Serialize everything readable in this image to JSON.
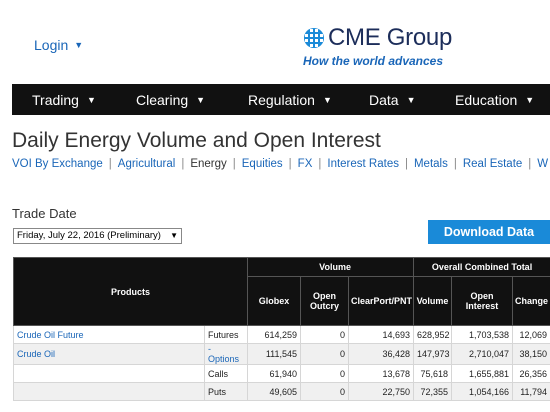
{
  "header": {
    "login_label": "Login",
    "logo_text": "CME Group",
    "tagline": "How the world advances"
  },
  "nav": {
    "items": [
      {
        "label": "Trading"
      },
      {
        "label": "Clearing"
      },
      {
        "label": "Regulation"
      },
      {
        "label": "Data"
      },
      {
        "label": "Education"
      }
    ]
  },
  "page": {
    "title": "Daily Energy Volume and Open Interest"
  },
  "subnav": {
    "items": [
      {
        "label": "VOI By Exchange"
      },
      {
        "label": "Agricultural"
      },
      {
        "label": "Energy"
      },
      {
        "label": "Equities"
      },
      {
        "label": "FX"
      },
      {
        "label": "Interest Rates"
      },
      {
        "label": "Metals"
      },
      {
        "label": "Real Estate"
      },
      {
        "label": "W"
      }
    ],
    "current": "Energy"
  },
  "trade_date": {
    "label": "Trade Date",
    "selected": "Friday, July 22, 2016 (Preliminary)"
  },
  "download_button": "Download Data",
  "table": {
    "group_headers": {
      "products": "Products",
      "volume": "Volume",
      "overall": "Overall Combined Total"
    },
    "columns": {
      "globex": "Globex",
      "open_outcry": "Open Outcry",
      "clearport": "ClearPort/PNT",
      "volume": "Volume",
      "open_interest": "Open Interest",
      "change": "Change"
    },
    "rows": [
      {
        "product": "Crude Oil Future",
        "type": "Futures",
        "globex": "614,259",
        "open_outcry": "0",
        "clearport": "14,693",
        "volume": "628,952",
        "open_interest": "1,703,538",
        "change": "12,069"
      },
      {
        "product": "Crude Oil",
        "type": "- Options",
        "globex": "111,545",
        "open_outcry": "0",
        "clearport": "36,428",
        "volume": "147,973",
        "open_interest": "2,710,047",
        "change": "38,150"
      },
      {
        "product": "",
        "type": "Calls",
        "globex": "61,940",
        "open_outcry": "0",
        "clearport": "13,678",
        "volume": "75,618",
        "open_interest": "1,655,881",
        "change": "26,356"
      },
      {
        "product": "",
        "type": "Puts",
        "globex": "49,605",
        "open_outcry": "0",
        "clearport": "22,750",
        "volume": "72,355",
        "open_interest": "1,054,166",
        "change": "11,794"
      }
    ]
  }
}
